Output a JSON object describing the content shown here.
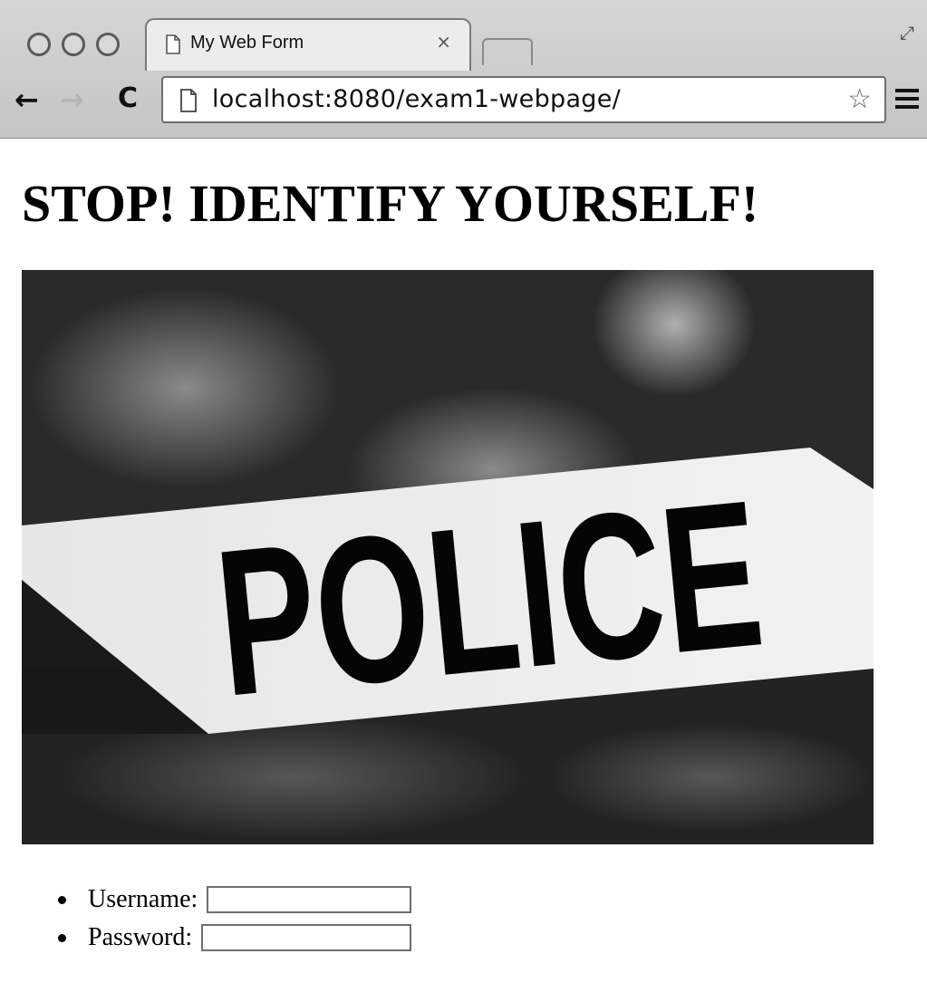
{
  "browser": {
    "tab_title": "My Web Form",
    "tab_close": "×",
    "url": "localhost:8080/exam1-webpage/",
    "back_glyph": "←",
    "forward_glyph": "→",
    "reload_glyph": "C",
    "star_glyph": "☆",
    "fullscreen_glyph": "⤢"
  },
  "page": {
    "heading": "STOP! IDENTIFY YOURSELF!",
    "image_sign_text": "POLICE",
    "form": {
      "username_label": "Username:",
      "username_value": "",
      "password_label": "Password:",
      "password_value": ""
    }
  },
  "icons": {
    "window_controls": [
      "close-icon",
      "minimize-icon",
      "zoom-icon"
    ],
    "tab": "page-icon",
    "menu": "hamburger-menu-icon"
  }
}
